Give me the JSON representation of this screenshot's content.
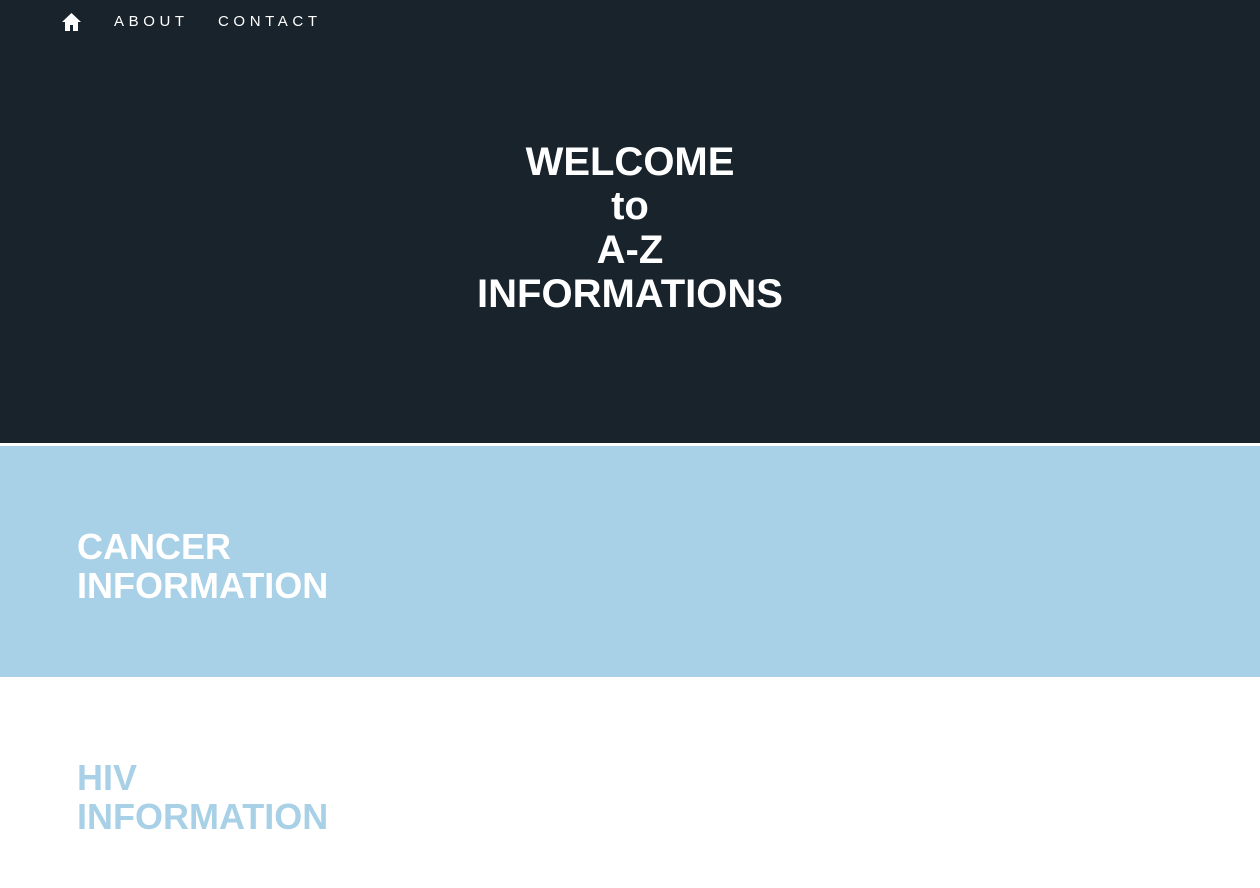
{
  "nav": {
    "home_icon": "home-icon",
    "about_label": "ABOUT",
    "contact_label": "CONTACT"
  },
  "hero": {
    "title_lines": [
      "WELCOME",
      "to",
      "A-Z",
      "INFORMATIONS"
    ]
  },
  "sections": [
    {
      "title_lines": [
        "CANCER",
        "INFORMATION"
      ]
    },
    {
      "title_lines": [
        "HIV",
        "INFORMATION"
      ]
    }
  ],
  "colors": {
    "hero_background": "#19232b",
    "accent_light_blue": "#a8d0e6",
    "text_white": "#ffffff"
  }
}
